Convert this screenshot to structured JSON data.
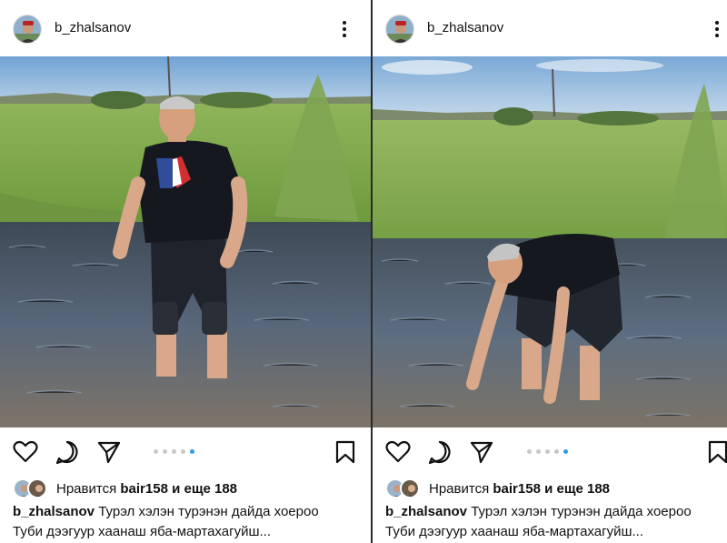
{
  "posts": [
    {
      "username": "b_zhalsanov",
      "likes_prefix": "Нравится",
      "likes_user": "bair158",
      "likes_suffix": "и еще 188",
      "caption_user": "b_zhalsanov",
      "caption_line1": "Турэл хэлэн турэнэн дайда хоероо",
      "caption_line2": "Туби дээгуур хаанаш яба-мартахагуйш...",
      "carousel": {
        "count": 5,
        "active_index": 4
      }
    },
    {
      "username": "b_zhalsanov",
      "likes_prefix": "Нравится",
      "likes_user": "bair158",
      "likes_suffix": "и еще 188",
      "caption_user": "b_zhalsanov",
      "caption_line1": "Турэл хэлэн турэнэн дайда хоероо",
      "caption_line2": "Туби дээгуур хаанаш яба-мартахагуйш...",
      "carousel": {
        "count": 5,
        "active_index": 4
      }
    }
  ],
  "icons": {
    "more": "more-vertical-icon",
    "like": "heart-icon",
    "comment": "comment-bubble-icon",
    "share": "paper-plane-icon",
    "save": "bookmark-icon"
  },
  "colors": {
    "carousel_active": "#2f9be8",
    "carousel_inactive": "#c8c8c8"
  }
}
